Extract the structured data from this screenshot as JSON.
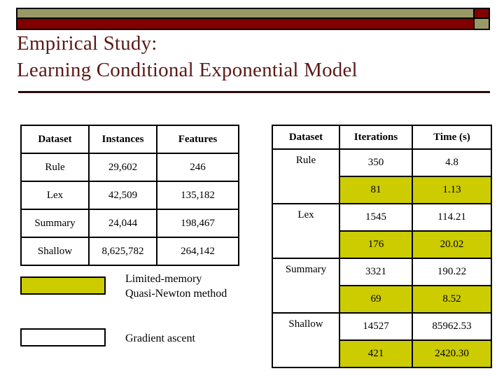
{
  "decor": {
    "band_top_color": "#999966",
    "band_bottom_color": "#800000",
    "title_color": "#5C1A17",
    "highlight_color": "#CCCC00"
  },
  "title": {
    "line1": "Empirical Study:",
    "line2": "Learning Conditional Exponential Model"
  },
  "left_table": {
    "headers": [
      "Dataset",
      "Instances",
      "Features"
    ],
    "rows": [
      {
        "dataset": "Rule",
        "instances": "29,602",
        "features": "246"
      },
      {
        "dataset": "Lex",
        "instances": "42,509",
        "features": "135,182"
      },
      {
        "dataset": "Summary",
        "instances": "24,044",
        "features": "198,467"
      },
      {
        "dataset": "Shallow",
        "instances": "8,625,782",
        "features": "264,142"
      }
    ]
  },
  "right_table": {
    "headers": [
      "Dataset",
      "Iterations",
      "Time (s)"
    ],
    "groups": [
      {
        "dataset": "Rule",
        "gradient": {
          "iterations": "350",
          "time": "4.8"
        },
        "lbfgs": {
          "iterations": "81",
          "time": "1.13"
        }
      },
      {
        "dataset": "Lex",
        "gradient": {
          "iterations": "1545",
          "time": "114.21"
        },
        "lbfgs": {
          "iterations": "176",
          "time": "20.02"
        }
      },
      {
        "dataset": "Summary",
        "gradient": {
          "iterations": "3321",
          "time": "190.22"
        },
        "lbfgs": {
          "iterations": "69",
          "time": "8.52"
        }
      },
      {
        "dataset": "Shallow",
        "gradient": {
          "iterations": "14527",
          "time": "85962.53"
        },
        "lbfgs": {
          "iterations": "421",
          "time": "2420.30"
        }
      }
    ]
  },
  "legend": {
    "lbfgs": {
      "line1": "Limited-memory",
      "line2": "Quasi-Newton method"
    },
    "gradient": {
      "line1": "Gradient ascent"
    }
  }
}
